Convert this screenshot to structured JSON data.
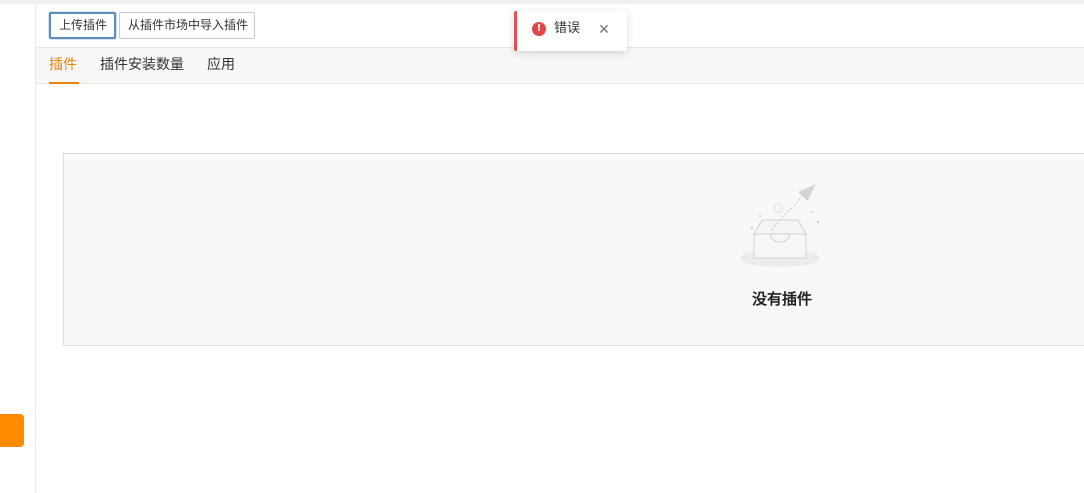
{
  "toolbar": {
    "upload_label": "上传插件",
    "import_label": "从插件市场中导入插件"
  },
  "tabs": [
    {
      "label": "插件",
      "active": true
    },
    {
      "label": "插件安装数量",
      "active": false
    },
    {
      "label": "应用",
      "active": false
    }
  ],
  "empty_state": {
    "message": "没有插件",
    "icon": "empty-inbox-paper-plane-icon"
  },
  "toast": {
    "type": "error",
    "message": "错误",
    "icon": "error-circle-icon",
    "close_icon": "close-icon"
  },
  "colors": {
    "accent": "#e8840c",
    "rail_accent": "#ff8a00",
    "error": "#e04848"
  }
}
